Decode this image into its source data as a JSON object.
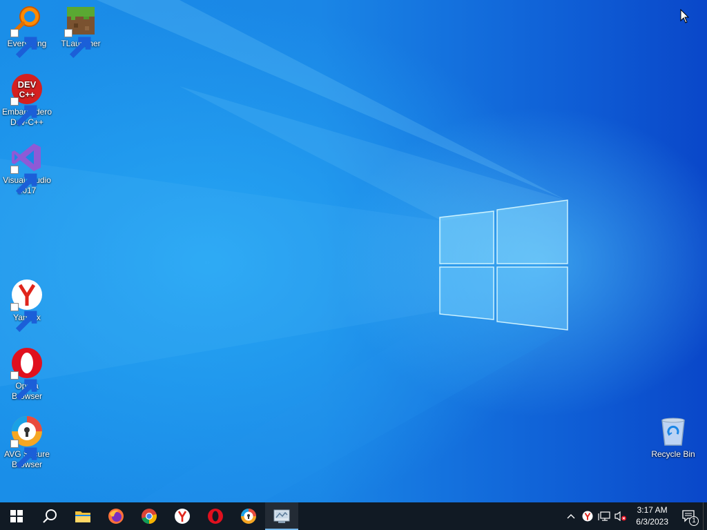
{
  "desktop": {
    "icons": [
      {
        "label": "Everything",
        "icon": "everything-icon"
      },
      {
        "label": "TLauncher",
        "icon": "tlauncher-icon"
      },
      {
        "label": "Embarcadero Dev-C++",
        "icon": "devcpp-icon",
        "icon_text": "DEV C++"
      },
      {
        "label": "Visual Studio 2017",
        "icon": "visual-studio-icon"
      },
      {
        "label": "Yandex",
        "icon": "yandex-icon"
      },
      {
        "label": "Opera Browser",
        "icon": "opera-icon"
      },
      {
        "label": "AVG Secure Browser",
        "icon": "avg-browser-icon"
      },
      {
        "label": "Recycle Bin",
        "icon": "recycle-bin-icon"
      }
    ]
  },
  "taskbar": {
    "pinned": [
      {
        "name": "start",
        "icon": "windows-logo-icon"
      },
      {
        "name": "search",
        "icon": "search-icon"
      },
      {
        "name": "file-explorer",
        "icon": "folder-icon"
      },
      {
        "name": "firefox",
        "icon": "firefox-icon"
      },
      {
        "name": "chrome",
        "icon": "chrome-icon"
      },
      {
        "name": "yandex",
        "icon": "yandex-icon"
      },
      {
        "name": "opera",
        "icon": "opera-icon"
      },
      {
        "name": "avg-browser",
        "icon": "avg-browser-icon"
      },
      {
        "name": "control-panel",
        "icon": "control-panel-icon",
        "active": true
      }
    ],
    "tray": {
      "icons": [
        "chevron-up-icon",
        "yandex-icon",
        "network-icon",
        "volume-muted-icon"
      ],
      "time": "3:17 AM",
      "date": "6/3/2023",
      "notification_count": "1"
    }
  },
  "colors": {
    "taskbar_bg": "#111a24",
    "active_indicator": "#76b9ed",
    "desktop_accent": "#1a8ee8"
  }
}
